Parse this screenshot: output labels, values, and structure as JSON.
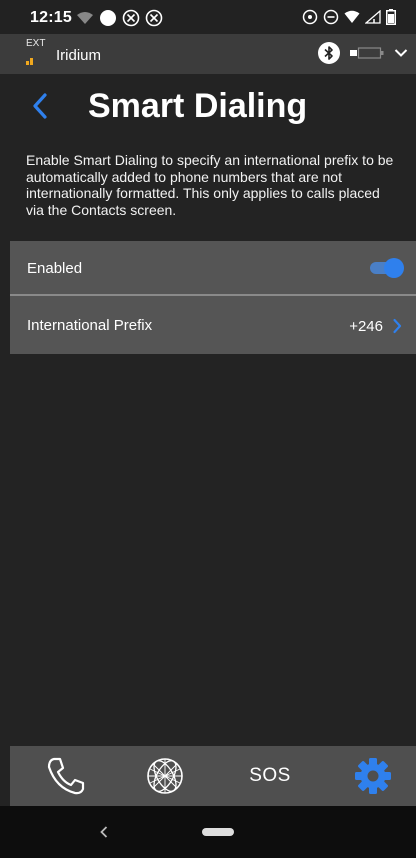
{
  "status_bar": {
    "time": "12:15",
    "left_icons": [
      "wifi-calling-icon",
      "dot-icon",
      "blocked-icon",
      "blocked-icon"
    ],
    "right_icons": [
      "alarm-icon",
      "dnd-icon",
      "wifi-icon",
      "signal-icon",
      "battery-icon"
    ]
  },
  "device_bar": {
    "ext_label": "EXT",
    "network_name": "Iridium",
    "icons": [
      "bluetooth-icon",
      "device-battery-icon",
      "chevron-down-icon"
    ]
  },
  "header": {
    "title": "Smart Dialing"
  },
  "description": "Enable Smart Dialing to specify an international prefix to be automatically added to phone numbers that are not internationally formatted. This only applies to calls placed via the Contacts screen.",
  "settings": {
    "enabled": {
      "label": "Enabled",
      "value": true
    },
    "international_prefix": {
      "label": "International Prefix",
      "value": "+246"
    }
  },
  "tab_bar": {
    "tabs": [
      {
        "id": "phone",
        "icon": "phone-icon"
      },
      {
        "id": "globe",
        "icon": "globe-icon"
      },
      {
        "id": "sos",
        "label": "SOS"
      },
      {
        "id": "settings",
        "icon": "gear-icon",
        "active": true
      }
    ]
  },
  "colors": {
    "accent": "#2f80ed",
    "background": "#232323",
    "row_background": "#555555",
    "signal": "#f0a81e"
  }
}
